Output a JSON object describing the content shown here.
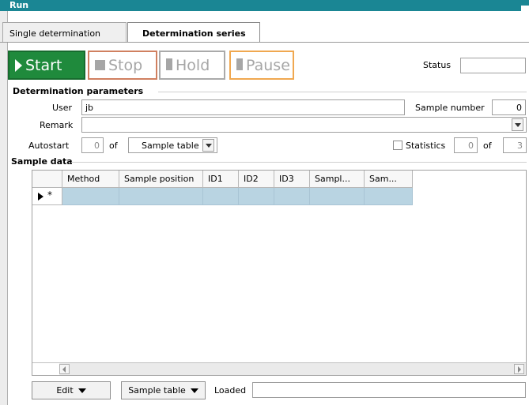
{
  "window": {
    "title": "Run"
  },
  "tabs": [
    {
      "label": "Single determination",
      "active": false
    },
    {
      "label": "Determination series",
      "active": true
    }
  ],
  "controls": {
    "start_label": "Start",
    "stop_label": "Stop",
    "hold_label": "Hold",
    "pause_label": "Pause",
    "status_label": "Status",
    "status_value": ""
  },
  "params": {
    "section_title": "Determination parameters",
    "user_label": "User",
    "user_value": "jb",
    "sample_number_label": "Sample number",
    "sample_number_value": "0",
    "remark_label": "Remark",
    "remark_value": "",
    "autostart_label": "Autostart",
    "autostart_value": "0",
    "of_label": "of",
    "autostart_source": "Sample table",
    "statistics_label": "Statistics",
    "statistics_checked": false,
    "statistics_value": "0",
    "statistics_of": "of",
    "statistics_total": "3"
  },
  "sample_data": {
    "section_title": "Sample data",
    "columns": [
      "Method",
      "Sample position",
      "ID1",
      "ID2",
      "ID3",
      "Sampl...",
      "Sam..."
    ],
    "new_row_marker": "*"
  },
  "bottom": {
    "edit_label": "Edit",
    "sample_table_label": "Sample table",
    "loaded_label": "Loaded",
    "loaded_value": ""
  },
  "colors": {
    "titlebar": "#1a8694",
    "start": "#1f8a3c",
    "stop_border": "#d08060",
    "pause_border": "#f0a850",
    "row_highlight": "#b9d4e2"
  }
}
